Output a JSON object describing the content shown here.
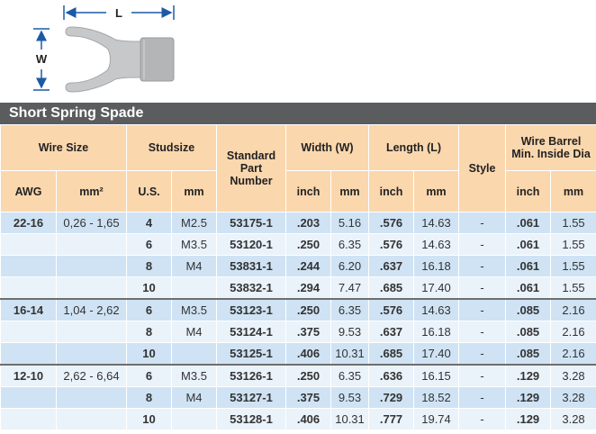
{
  "diagram": {
    "length_label": "L",
    "width_label": "W",
    "colors": {
      "arrow": "#1c5aa6",
      "terminal": "#c7c8ca",
      "barrel": "#b4b5b7"
    }
  },
  "section_title": "Short Spring Spade",
  "headers": {
    "wire_size": "Wire Size",
    "studsize": "Studsize",
    "part_line1": "Standard",
    "part_line2": "Part",
    "part_line3": "Number",
    "width": "Width (W)",
    "length": "Length (L)",
    "style": "Style",
    "barrel_line1": "Wire Barrel",
    "barrel_line2": "Min. Inside Dia",
    "awg": "AWG",
    "mm2": "mm²",
    "us": "U.S.",
    "mm": "mm",
    "inch": "inch"
  },
  "colors": {
    "header_bg": "#fbd7ae",
    "row_dark": "#cfe3f4",
    "row_light": "#eaf2fa",
    "title_bg": "#5a5c5e",
    "accent": "#1c5aa6"
  },
  "rows": [
    {
      "awg": "22-16",
      "mm2": "0,26 - 1,65",
      "us": "4",
      "stud_mm": "M2.5",
      "part": "53175-1",
      "w_in": ".203",
      "w_mm": "5.16",
      "l_in": ".576",
      "l_mm": "14.63",
      "style": "-",
      "b_in": ".061",
      "b_mm": "1.55"
    },
    {
      "awg": "",
      "mm2": "",
      "us": "6",
      "stud_mm": "M3.5",
      "part": "53120-1",
      "w_in": ".250",
      "w_mm": "6.35",
      "l_in": ".576",
      "l_mm": "14.63",
      "style": "-",
      "b_in": ".061",
      "b_mm": "1.55"
    },
    {
      "awg": "",
      "mm2": "",
      "us": "8",
      "stud_mm": "M4",
      "part": "53831-1",
      "w_in": ".244",
      "w_mm": "6.20",
      "l_in": ".637",
      "l_mm": "16.18",
      "style": "-",
      "b_in": ".061",
      "b_mm": "1.55"
    },
    {
      "awg": "",
      "mm2": "",
      "us": "10",
      "stud_mm": "",
      "part": "53832-1",
      "w_in": ".294",
      "w_mm": "7.47",
      "l_in": ".685",
      "l_mm": "17.40",
      "style": "-",
      "b_in": ".061",
      "b_mm": "1.55"
    },
    {
      "awg": "16-14",
      "mm2": "1,04 - 2,62",
      "us": "6",
      "stud_mm": "M3.5",
      "part": "53123-1",
      "w_in": ".250",
      "w_mm": "6.35",
      "l_in": ".576",
      "l_mm": "14.63",
      "style": "-",
      "b_in": ".085",
      "b_mm": "2.16"
    },
    {
      "awg": "",
      "mm2": "",
      "us": "8",
      "stud_mm": "M4",
      "part": "53124-1",
      "w_in": ".375",
      "w_mm": "9.53",
      "l_in": ".637",
      "l_mm": "16.18",
      "style": "-",
      "b_in": ".085",
      "b_mm": "2.16"
    },
    {
      "awg": "",
      "mm2": "",
      "us": "10",
      "stud_mm": "",
      "part": "53125-1",
      "w_in": ".406",
      "w_mm": "10.31",
      "l_in": ".685",
      "l_mm": "17.40",
      "style": "-",
      "b_in": ".085",
      "b_mm": "2.16"
    },
    {
      "awg": "12-10",
      "mm2": "2,62 - 6,64",
      "us": "6",
      "stud_mm": "M3.5",
      "part": "53126-1",
      "w_in": ".250",
      "w_mm": "6.35",
      "l_in": ".636",
      "l_mm": "16.15",
      "style": "-",
      "b_in": ".129",
      "b_mm": "3.28"
    },
    {
      "awg": "",
      "mm2": "",
      "us": "8",
      "stud_mm": "M4",
      "part": "53127-1",
      "w_in": ".375",
      "w_mm": "9.53",
      "l_in": ".729",
      "l_mm": "18.52",
      "style": "-",
      "b_in": ".129",
      "b_mm": "3.28"
    },
    {
      "awg": "",
      "mm2": "",
      "us": "10",
      "stud_mm": "",
      "part": "53128-1",
      "w_in": ".406",
      "w_mm": "10.31",
      "l_in": ".777",
      "l_mm": "19.74",
      "style": "-",
      "b_in": ".129",
      "b_mm": "3.28"
    }
  ]
}
